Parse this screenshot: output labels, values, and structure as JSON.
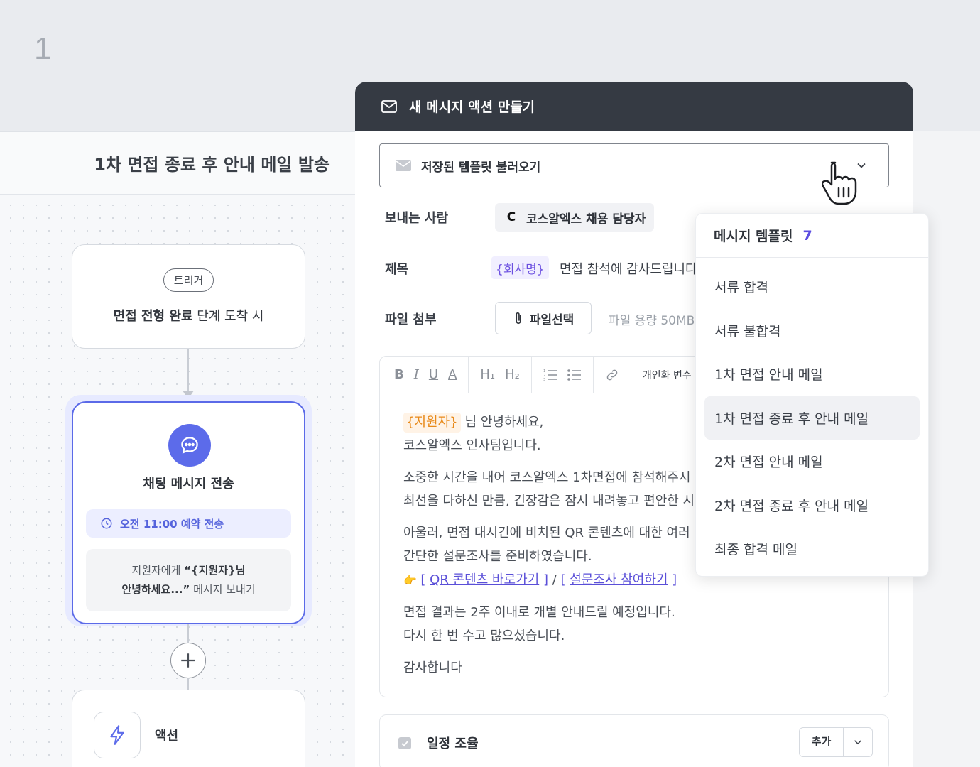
{
  "step_number": "1",
  "workflow": {
    "title": "1차 면접 종료 후 안내 메일 발송",
    "trigger": {
      "pill": "트리거",
      "text_bold": "면접 전형 완료",
      "text_rest": " 단계 도착 시"
    },
    "chat_node": {
      "title": "채팅 메시지 전송",
      "schedule": "오전 11:00 예약 전송",
      "preview_line1_prefix": "지원자에게 ",
      "preview_line1_bold": "“{지원자}님",
      "preview_line2_bold": "안녕하세요...”",
      "preview_line2_rest": " 메시지 보내기"
    },
    "action_node": {
      "label": "액션"
    }
  },
  "modal": {
    "title": "새 메시지 액션 만들기",
    "template_select": "저장된 템플릿 불러오기",
    "sender_label": "보내는 사람",
    "sender_logo": "C",
    "sender_value": "코스알엑스 채용 담당자",
    "subject_label": "제목",
    "subject_var": "{회사명}",
    "subject_text": "면접 참석에 감사드립니다",
    "file_label": "파일 첨부",
    "file_button": "파일선택",
    "file_hint": "파일 용량 50MB",
    "toolbar": {
      "bold": "B",
      "italic": "I",
      "underline": "U",
      "color": "A",
      "h1": "H₁",
      "h2": "H₂",
      "personal": "개인화 변수"
    },
    "body": {
      "greeting_var": "{지원자}",
      "greeting_rest": "님 안녕하세요,",
      "line2": "코스알엑스 인사팀입니다.",
      "para2_line1": "소중한 시간을 내어 코스알엑스 1차면접에 참석해주시",
      "para2_line2": "최선을 다하신 만큼, 긴장감은 잠시 내려놓고 편안한 시",
      "para3_line1": "아울러, 면접 대시긴에 비치된 QR 콘텐츠에 대한 여러",
      "para3_line2": "간단한 설문조사를 준비하였습니다.",
      "link_prefix_emoji": "👉",
      "link1": "QR 콘텐츠 바로가기",
      "link2": "설문조사 참여하기",
      "para4_line1": "면접 결과는 2주 이내로 개별 안내드릴 예정입니다.",
      "para4_line2": "다시 한 번 수고 많으셨습니다.",
      "closing": "감사합니다"
    },
    "schedule_card": {
      "label": "일정 조율",
      "add": "추가"
    }
  },
  "menu": {
    "title": "메시지 템플릿",
    "count": "7",
    "items": [
      "서류 합격",
      "서류 불합격",
      "1차 면접 안내 메일",
      "1차 면접 종료 후 안내 메일",
      "2차 면접 안내 메일",
      "2차 면접 종료 후 안내 메일",
      "최종 합격 메일"
    ],
    "active_index": 3
  },
  "colors": {
    "accent": "#5c6bea",
    "header_dark": "#353a43",
    "variable_purple": "#6b4fe0",
    "variable_orange": "#e88a1a"
  }
}
